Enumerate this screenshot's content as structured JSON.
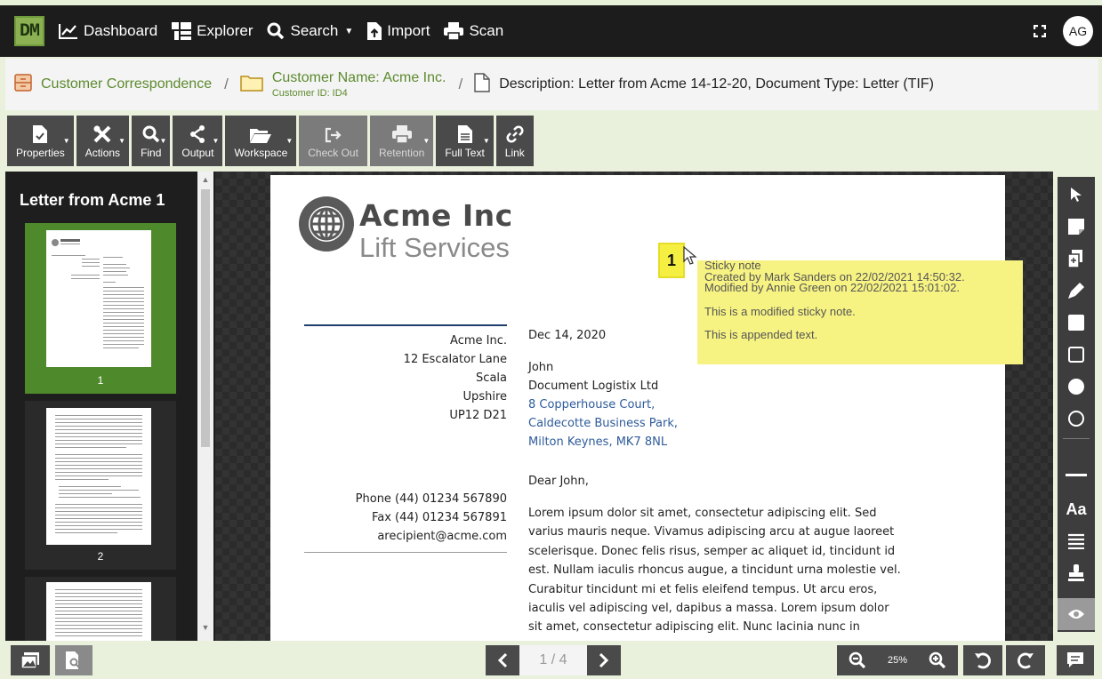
{
  "app": {
    "logo_text": "DM",
    "nav": [
      {
        "label": "Dashboard",
        "icon": "chart-line-icon"
      },
      {
        "label": "Explorer",
        "icon": "explorer-icon"
      },
      {
        "label": "Search",
        "icon": "search-icon"
      },
      {
        "label": "Import",
        "icon": "import-icon"
      },
      {
        "label": "Scan",
        "icon": "printer-icon"
      }
    ],
    "user_initials": "AG"
  },
  "breadcrumb": {
    "folder_label": "Customer Correspondence",
    "customer_name": "Customer Name: Acme Inc.",
    "customer_id": "Customer ID: ID4",
    "document_label": "Description: Letter from Acme 14-12-20, Document Type: Letter (TIF)"
  },
  "toolbar": {
    "buttons": [
      {
        "label": "Properties",
        "icon": "properties-icon",
        "dropdown": true
      },
      {
        "label": "Actions",
        "icon": "tools-icon",
        "dropdown": true
      },
      {
        "label": "Find",
        "icon": "search-icon",
        "dropdown": true
      },
      {
        "label": "Output",
        "icon": "share-icon",
        "dropdown": true
      },
      {
        "label": "Workspace",
        "icon": "folder-open-icon",
        "dropdown": true
      },
      {
        "label": "Check Out",
        "icon": "sign-out-icon",
        "dropdown": false
      },
      {
        "label": "Retention",
        "icon": "printer-icon",
        "dropdown": true
      },
      {
        "label": "Full Text",
        "icon": "file-text-icon",
        "dropdown": true
      },
      {
        "label": "Link",
        "icon": "link-icon",
        "dropdown": false
      }
    ]
  },
  "thumbnails": {
    "title": "Letter from Acme 1",
    "pages": [
      "1",
      "2"
    ]
  },
  "document": {
    "company": "Acme Inc",
    "tagline": "Lift Services",
    "sender_address": [
      "Acme Inc.",
      "12 Escalator Lane",
      "Scala",
      "Upshire",
      "UP12 D21"
    ],
    "sender_contact": [
      "Phone (44) 01234 567890",
      "Fax (44) 01234 567891",
      "arecipient@acme.com"
    ],
    "date": "Dec 14, 2020",
    "recipient_name": "John",
    "recipient_company": "Document Logistix Ltd",
    "recipient_address": [
      "8 Copperhouse Court,",
      "Caldecotte Business Park,",
      "Milton Keynes, MK7 8NL"
    ],
    "salutation": "Dear John,",
    "body": "Lorem ipsum dolor sit amet, consectetur adipiscing elit. Sed varius mauris neque. Vivamus adipiscing arcu at augue laoreet scelerisque. Donec felis risus, semper ac aliquet id, tincidunt id est. Nullam iaculis rhoncus augue, a tincidunt urna molestie vel. Curabitur tincidunt mi et felis eleifend tempus. Ut arcu eros, iaculis vel adipiscing vel, dapibus a massa. Lorem ipsum dolor sit amet, consectetur adipiscing elit. Nunc lacinia nunc in"
  },
  "sticky_note": {
    "marker": "1",
    "title": "Sticky note",
    "created": "Created by Mark Sanders on 22/02/2021 14:50:32.",
    "modified": "Modified by Annie Green on 22/02/2021 15:01:02.",
    "text1": "This is a modified sticky note.",
    "text2": "This is appended text."
  },
  "pager": {
    "display": "1 / 4",
    "current": 1,
    "total": 4
  },
  "zoom": {
    "level": "25%"
  },
  "annotation_tools": [
    "pointer-icon",
    "sticky-note-icon",
    "stamp-copy-icon",
    "highlighter-icon",
    "filled-rectangle-icon",
    "rectangle-icon",
    "filled-circle-icon",
    "circle-icon",
    "line-icon",
    "text-icon",
    "lines-icon",
    "stamp-icon",
    "eye-icon"
  ],
  "annotation_text_label": "Aa",
  "colors": {
    "accent": "#4e8a2c",
    "breadcrumb_text": "#5c8a2e",
    "sticky": "#f7f383"
  }
}
